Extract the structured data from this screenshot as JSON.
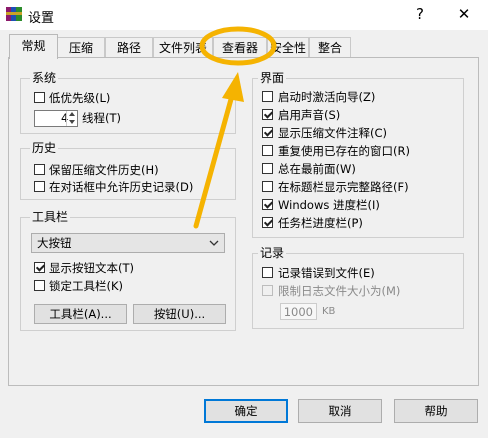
{
  "window": {
    "title": "设置",
    "help_glyph": "?",
    "close_glyph": "✕"
  },
  "tabs": [
    {
      "label": "常规",
      "active": true
    },
    {
      "label": "压缩"
    },
    {
      "label": "路径"
    },
    {
      "label": "文件列表"
    },
    {
      "label": "查看器"
    },
    {
      "label": "安全性"
    },
    {
      "label": "整合"
    }
  ],
  "system": {
    "title": "系统",
    "low_priority": {
      "label": "低优先级(L)",
      "checked": false
    },
    "threads_value": "4",
    "threads_label": "线程(T)"
  },
  "history": {
    "title": "历史",
    "keep_archive_history": {
      "label": "保留压缩文件历史(H)",
      "checked": false
    },
    "allow_dialog_history": {
      "label": "在对话框中允许历史记录(D)",
      "checked": false
    }
  },
  "toolbar": {
    "title": "工具栏",
    "size_selected": "大按钮",
    "show_text": {
      "label": "显示按钮文本(T)",
      "checked": true
    },
    "lock": {
      "label": "锁定工具栏(K)",
      "checked": false
    },
    "toolbar_button": "工具栏(A)...",
    "buttons_button": "按钮(U)..."
  },
  "interface": {
    "title": "界面",
    "items": [
      {
        "label": "启动时激活向导(Z)",
        "checked": false
      },
      {
        "label": "启用声音(S)",
        "checked": true
      },
      {
        "label": "显示压缩文件注释(C)",
        "checked": true
      },
      {
        "label": "重复使用已存在的窗口(R)",
        "checked": false
      },
      {
        "label": "总在最前面(W)",
        "checked": false
      },
      {
        "label": "在标题栏显示完整路径(F)",
        "checked": false
      },
      {
        "label": "Windows 进度栏(I)",
        "checked": true
      },
      {
        "label": "任务栏进度栏(P)",
        "checked": true
      }
    ]
  },
  "log": {
    "title": "记录",
    "log_errors": {
      "label": "记录错误到文件(E)",
      "checked": false
    },
    "limit_size": {
      "label": "限制日志文件大小为(M)",
      "checked": false,
      "disabled": true
    },
    "size_value": "1000",
    "size_unit": "KB"
  },
  "footer": {
    "ok": "确定",
    "cancel": "取消",
    "help": "帮助"
  },
  "colors": {
    "annotation": "#f5b301",
    "focus": "#0078d7",
    "check": "#222222"
  }
}
